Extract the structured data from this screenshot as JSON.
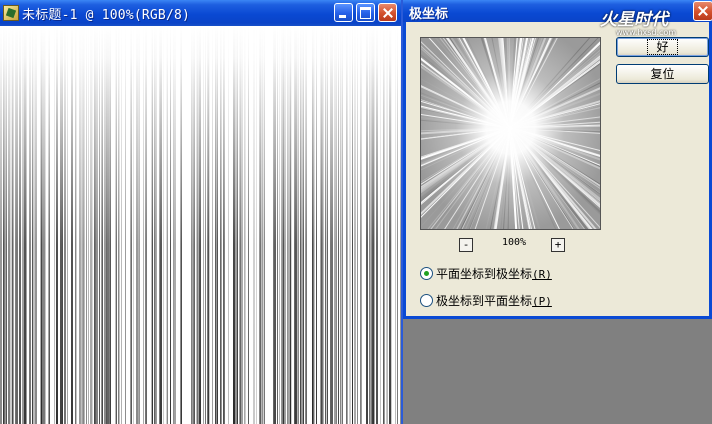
{
  "document": {
    "title": "未标题-1 @ 100%(RGB/8)"
  },
  "dialog": {
    "title": "极坐标",
    "ok_label": "好",
    "reset_label": "复位",
    "zoom_minus": "-",
    "zoom_plus": "+",
    "zoom_level": "100%",
    "options": [
      {
        "label": "平面坐标到极坐标",
        "hotkey": "(R)",
        "selected": true
      },
      {
        "label": "极坐标到平面坐标",
        "hotkey": "(P)",
        "selected": false
      }
    ]
  },
  "watermark": {
    "text": "火星时代",
    "subtext": "www.hxsd.com"
  },
  "colors": {
    "titlebar_blue": "#0a49d3",
    "dialog_bg": "#ece9d8",
    "workspace_grey": "#808080",
    "radio_green": "#21a121"
  },
  "icons": {
    "doc_app": "photoshop-document-icon",
    "minimize": "minimize-icon",
    "maximize": "maximize-icon",
    "close": "close-icon"
  }
}
